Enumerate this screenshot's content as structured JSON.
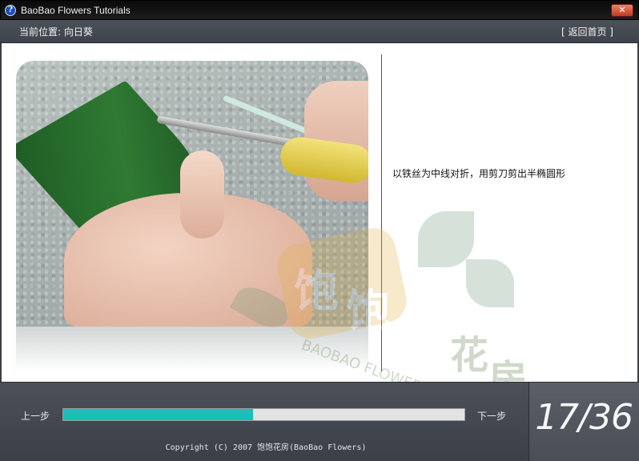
{
  "window": {
    "title": "BaoBao Flowers Tutorials",
    "app_icon_glyph": "?",
    "close_glyph": "✕"
  },
  "header": {
    "location": "当前位置: 向日葵",
    "home_link": "[ 返回首页 ]"
  },
  "content": {
    "instruction": "以铁丝为中线对折，用剪刀剪出半椭圆形",
    "watermark": {
      "chars": [
        "饱",
        "饱",
        "花",
        "房"
      ],
      "text": "BAOBAO FLOWERS"
    }
  },
  "footer": {
    "prev_label": "上一步",
    "next_label": "下一步",
    "progress_fraction": 0.4722,
    "copyright": "Copyright (C) 2007 饱饱花房(BaoBao Flowers)",
    "counter": "17/36"
  },
  "colors": {
    "progress_fill": "#19c0b8",
    "chrome_dark": "#3f434b"
  },
  "icons": {
    "app_icon": "help-question-icon",
    "close_icon": "close-icon"
  }
}
